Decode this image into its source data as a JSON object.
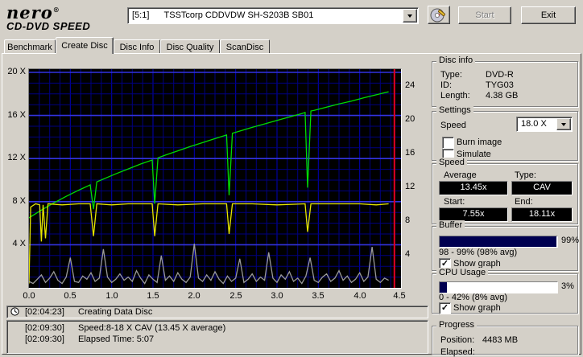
{
  "colors": {
    "window_bg": "#d4d0c8",
    "grid_minor": "#000080",
    "grid_mid": "#0000bb",
    "grid_major": "#3333e0",
    "series_green": "#00dc00",
    "series_yellow": "#e6e600",
    "series_gray": "#9a9a9a",
    "marker_red": "#e00024",
    "bar_fill": "#000050",
    "lcd_bg": "#000000",
    "lcd_text": "#ffffff"
  },
  "header": {
    "logo": {
      "brand": "nero",
      "reg": "®",
      "product": "CD-DVD SPEED"
    },
    "drive": {
      "value": "[5:1]      TSSTcorp CDDVDW SH-S203B SB01"
    },
    "start_button": "Start",
    "exit_button": "Exit"
  },
  "tabs": {
    "items": [
      "Benchmark",
      "Create Disc",
      "Disc Info",
      "Disc Quality",
      "ScanDisc"
    ],
    "active": "Create Disc"
  },
  "chart_data": {
    "type": "line",
    "title": "Create Disc write speed graph",
    "x_axis": {
      "min": 0,
      "max": 4.5,
      "ticks": [
        "0.0",
        "0.5",
        "1.0",
        "1.5",
        "2.0",
        "2.5",
        "3.0",
        "3.5",
        "4.0",
        "4.5"
      ]
    },
    "y_axis_left": {
      "min": 0,
      "max": 20.3,
      "ticks": [
        "20 X",
        "16 X",
        "12 X",
        "8 X",
        "4 X"
      ],
      "tick_values": [
        20,
        16,
        12,
        8,
        4
      ]
    },
    "y_axis_right": {
      "min": 0,
      "max": 26,
      "ticks": [
        "24",
        "20",
        "16",
        "12",
        "8",
        "4"
      ],
      "tick_values": [
        24,
        20,
        16,
        12,
        8,
        4
      ]
    },
    "grid": {
      "x_minor_step": 0.125,
      "x_major_step": 0.5,
      "y_minor_step": 1,
      "y_major_step": 4
    },
    "series": [
      {
        "name": "write-speed",
        "color": "#00dc00",
        "points": [
          [
            0,
            6.5
          ],
          [
            0.15,
            7.22
          ],
          [
            0.3,
            7.88
          ],
          [
            0.45,
            8.49
          ],
          [
            0.6,
            9.06
          ],
          [
            0.74,
            9.56
          ],
          [
            0.78,
            7.3
          ],
          [
            0.82,
            9.84
          ],
          [
            0.9,
            10.1
          ],
          [
            1.05,
            10.58
          ],
          [
            1.2,
            11.04
          ],
          [
            1.35,
            11.49
          ],
          [
            1.49,
            11.87
          ],
          [
            1.52,
            7.8
          ],
          [
            1.56,
            12.07
          ],
          [
            1.65,
            12.32
          ],
          [
            1.8,
            12.72
          ],
          [
            1.95,
            13.11
          ],
          [
            2.1,
            13.48
          ],
          [
            2.25,
            13.85
          ],
          [
            2.39,
            14.19
          ],
          [
            2.42,
            8.6
          ],
          [
            2.46,
            14.35
          ],
          [
            2.55,
            14.55
          ],
          [
            2.7,
            14.9
          ],
          [
            2.85,
            15.22
          ],
          [
            3,
            15.54
          ],
          [
            3.15,
            15.86
          ],
          [
            3.3,
            16.17
          ],
          [
            3.34,
            16.28
          ],
          [
            3.37,
            9.3
          ],
          [
            3.41,
            16.42
          ],
          [
            3.45,
            16.47
          ],
          [
            3.6,
            16.77
          ],
          [
            3.75,
            17.07
          ],
          [
            3.9,
            17.34
          ],
          [
            4.05,
            17.64
          ],
          [
            4.2,
            17.92
          ],
          [
            4.35,
            18.2
          ]
        ]
      },
      {
        "name": "secondary-speed",
        "color": "#e6e600",
        "points": [
          [
            0,
            0.4
          ],
          [
            0.02,
            7.5
          ],
          [
            0.08,
            7.8
          ],
          [
            0.13,
            7.7
          ],
          [
            0.15,
            4.3
          ],
          [
            0.17,
            7.7
          ],
          [
            0.2,
            4.6
          ],
          [
            0.23,
            7.8
          ],
          [
            0.4,
            7.7
          ],
          [
            0.6,
            7.8
          ],
          [
            0.74,
            7.8
          ],
          [
            0.78,
            4.8
          ],
          [
            0.82,
            7.8
          ],
          [
            1,
            7.7
          ],
          [
            1.2,
            7.8
          ],
          [
            1.49,
            7.8
          ],
          [
            1.52,
            4.8
          ],
          [
            1.56,
            7.8
          ],
          [
            1.8,
            7.7
          ],
          [
            2.1,
            7.8
          ],
          [
            2.39,
            7.8
          ],
          [
            2.42,
            5
          ],
          [
            2.46,
            7.8
          ],
          [
            2.7,
            7.8
          ],
          [
            3,
            7.7
          ],
          [
            3.34,
            7.8
          ],
          [
            3.37,
            5.2
          ],
          [
            3.41,
            7.8
          ],
          [
            3.7,
            7.8
          ],
          [
            4,
            7.8
          ],
          [
            4.2,
            7.7
          ],
          [
            4.35,
            7.8
          ]
        ]
      },
      {
        "name": "cpu-usage-graph",
        "color": "#9a9a9a",
        "x_start": 0,
        "x_step": 0.05,
        "values": [
          0.6,
          0.4,
          0.8,
          1.2,
          0.5,
          0.9,
          1.5,
          0.7,
          0.4,
          1.0,
          2.8,
          0.6,
          0.5,
          1.1,
          0.8,
          1.4,
          0.6,
          0.9,
          3.6,
          1.0,
          0.5,
          0.8,
          1.3,
          0.7,
          1.0,
          0.6,
          1.6,
          0.9,
          0.4,
          1.2,
          0.8,
          0.5,
          3.0,
          0.7,
          1.1,
          0.6,
          1.4,
          0.8,
          0.5,
          1.0,
          4.1,
          0.9,
          0.6,
          1.2,
          0.7,
          1.5,
          0.8,
          0.4,
          1.1,
          0.6,
          0.9,
          2.7,
          0.5,
          0.8,
          1.3,
          0.6,
          1.0,
          0.7,
          3.3,
          0.9,
          0.5,
          1.2,
          0.8,
          1.5,
          0.6,
          0.9,
          0.4,
          1.1,
          2.8,
          0.7,
          0.5,
          1.0,
          1.3,
          0.6,
          0.9,
          1.6,
          0.7,
          1.1,
          0.5,
          0.8,
          1.4,
          0.6,
          1.0,
          3.8,
          0.8,
          0.5,
          0.9,
          0.7
        ]
      }
    ],
    "marker": {
      "type": "vline",
      "x": 4.42,
      "color": "#e00024"
    }
  },
  "panels": {
    "disc_info": {
      "title": "Disc info",
      "rows": [
        {
          "label": "Type:",
          "value": "DVD-R"
        },
        {
          "label": "ID:",
          "value": "TYG03"
        },
        {
          "label": "Length:",
          "value": "4.38 GB"
        }
      ]
    },
    "settings": {
      "title": "Settings",
      "speed_label": "Speed",
      "speed_value": "18.0 X",
      "checkboxes": [
        {
          "label": "Burn image",
          "checked": false
        },
        {
          "label": "Simulate",
          "checked": false
        }
      ]
    },
    "speed": {
      "title": "Speed",
      "average_label": "Average",
      "type_label": "Type:",
      "average_value": "13.45x",
      "type_value": "CAV",
      "start_label": "Start:",
      "end_label": "End:",
      "start_value": "7.55x",
      "end_value": "18.11x"
    },
    "buffer": {
      "title": "Buffer",
      "percent": "99%",
      "fill": 0.99,
      "range_text": "98 - 99% (98% avg)",
      "show_graph_label": "Show graph",
      "show_graph_checked": true
    },
    "cpu": {
      "title": "CPU Usage",
      "percent": "3%",
      "fill": 0.06,
      "range_text": "0 - 42% (8% avg)",
      "show_graph_label": "Show graph",
      "show_graph_checked": true
    },
    "progress": {
      "title": "Progress",
      "position_label": "Position:",
      "position_value": "4483 MB",
      "elapsed_label": "Elapsed:",
      "elapsed_value": ""
    }
  },
  "log": {
    "row1": {
      "time": "[02:04:23]",
      "text": "Creating Data Disc"
    },
    "rows": [
      {
        "time": "[02:09:30]",
        "text": "Speed:8-18 X CAV (13.45 X average)"
      },
      {
        "time": "[02:09:30]",
        "text": "Elapsed Time: 5:07"
      }
    ]
  }
}
